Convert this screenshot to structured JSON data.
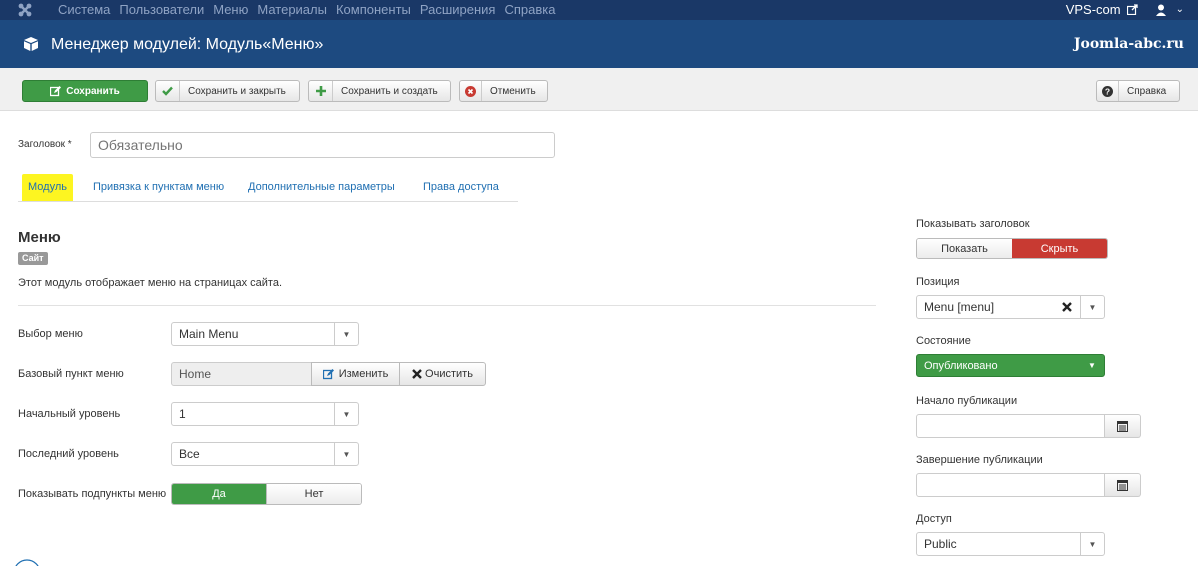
{
  "navbar": {
    "menu": [
      "Система",
      "Пользователи",
      "Меню",
      "Материалы",
      "Компоненты",
      "Расширения",
      "Справка"
    ],
    "site_link": "VPS-com",
    "user_menu_caret": "⌄"
  },
  "titlebar": {
    "title": "Менеджер модулей: Модуль«Меню»",
    "brand": "Joomla-abc.ru"
  },
  "toolbar": {
    "save": "Сохранить",
    "save_close": "Сохранить и закрыть",
    "save_new": "Сохранить и создать",
    "cancel": "Отменить",
    "help": "Справка"
  },
  "title_field": {
    "label": "Заголовок *",
    "placeholder": "Обязательно"
  },
  "tabs": [
    {
      "label": "Модуль",
      "active": true
    },
    {
      "label": "Привязка к пунктам меню",
      "active": false
    },
    {
      "label": "Дополнительные параметры",
      "active": false
    },
    {
      "label": "Права доступа",
      "active": false
    }
  ],
  "module": {
    "heading": "Меню",
    "badge": "Сайт",
    "description": "Этот модуль отображает меню на страницах сайта."
  },
  "form": {
    "menu_select": {
      "label": "Выбор меню",
      "value": "Main Menu"
    },
    "base_item": {
      "label": "Базовый пункт меню",
      "value": "Home",
      "change": "Изменить",
      "clear": "Очистить"
    },
    "start_level": {
      "label": "Начальный уровень",
      "value": "1"
    },
    "end_level": {
      "label": "Последний уровень",
      "value": "Все"
    },
    "show_subitems": {
      "label": "Показывать подпункты меню",
      "yes": "Да",
      "no": "Нет",
      "selected": "yes"
    }
  },
  "sidebar": {
    "show_title": {
      "label": "Показывать заголовок",
      "show": "Показать",
      "hide": "Скрыть",
      "selected": "hide"
    },
    "position": {
      "label": "Позиция",
      "value": "Menu [menu]"
    },
    "state": {
      "label": "Состояние",
      "value": "Опубликовано"
    },
    "publish_up": {
      "label": "Начало публикации",
      "value": ""
    },
    "publish_down": {
      "label": "Завершение публикации",
      "value": ""
    },
    "access": {
      "label": "Доступ",
      "value": "Public"
    }
  },
  "colors": {
    "navbar": "#1a3867",
    "titlebar": "#1d4a80",
    "save_green": "#3f9b46",
    "hide_red": "#c83a32",
    "published_green": "#3f9b46",
    "active_tab_highlight": "#fdf521",
    "link_blue": "#1f6fb2"
  }
}
